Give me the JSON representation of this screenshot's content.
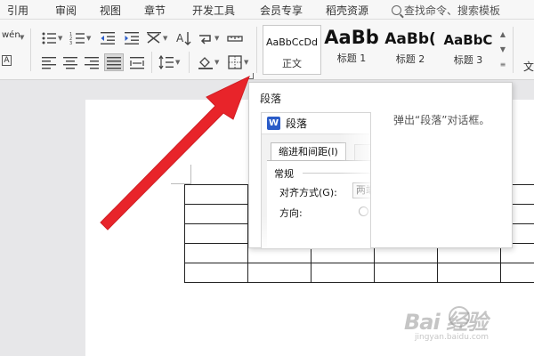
{
  "menubar": {
    "tabs": [
      "引用",
      "审阅",
      "视图",
      "章节",
      "开发工具",
      "会员专享",
      "稻壳资源"
    ],
    "search_placeholder": "查找命令、搜索模板"
  },
  "ribbon": {
    "phonetic_label": "wén",
    "char_border_label": "A",
    "styles": [
      {
        "sample": "AaBbCcDd",
        "name": "正文"
      },
      {
        "sample": "AaBb",
        "name": "标题 1"
      },
      {
        "sample": "AaBb(",
        "name": "标题 2"
      },
      {
        "sample": "AaBbC",
        "name": "标题 3"
      }
    ],
    "truncated_right_label": "文"
  },
  "tooltip": {
    "title": "段落",
    "description": "弹出“段落”对话框。",
    "preview": {
      "logo_letter": "W",
      "dialog_title": "段落",
      "tab_label": "缩进和间距(I)",
      "group_label": "常规",
      "alignment_label": "对齐方式(G):",
      "alignment_value": "两端",
      "direction_label": "方向:"
    }
  },
  "colors": {
    "arrow": "#e8242a",
    "wps_blue": "#2b5cc8",
    "ribbon_bg": "#f7f7f7",
    "workspace_bg": "#e7e7e9"
  },
  "watermark": {
    "logo": "Bai 经验",
    "url": "jingyan.baidu.com"
  }
}
